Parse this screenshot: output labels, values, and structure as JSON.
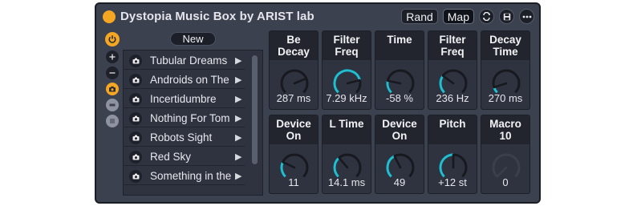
{
  "device": {
    "title": "Dystopia Music Box by ARIST lab",
    "rand_label": "Rand",
    "map_label": "Map"
  },
  "left_strip": {
    "buttons": [
      "power-icon",
      "plus-icon",
      "minus-icon",
      "camera-icon",
      "stop-icon",
      "list-icon"
    ]
  },
  "list": {
    "new_label": "New",
    "items": [
      {
        "label": "Tubular Dreams"
      },
      {
        "label": "Androids on The"
      },
      {
        "label": "Incertidumbre"
      },
      {
        "label": "Nothing For Tom"
      },
      {
        "label": "Robots Sight"
      },
      {
        "label": "Red Sky"
      },
      {
        "label": "Something in the"
      }
    ]
  },
  "knobs": [
    {
      "label": "Be\nDecay",
      "value": "287 ms",
      "level": 0.75,
      "color": "#1b1d24"
    },
    {
      "label": "Filter\nFreq",
      "value": "7.29 kHz",
      "level": 0.78,
      "color": "#1fbfd1"
    },
    {
      "label": "Time",
      "value": "-58 %",
      "level": 0.21,
      "color": "#1fbfd1"
    },
    {
      "label": "Filter\nFreq",
      "value": "236 Hz",
      "level": 0.3,
      "color": "#1fbfd1"
    },
    {
      "label": "Decay\nTime",
      "value": "270 ms",
      "level": 0.1,
      "color": "#1fbfd1"
    },
    {
      "label": "Device\nOn",
      "value": "11",
      "level": 0.26,
      "color": "#1fbfd1"
    },
    {
      "label": "L Time",
      "value": "14.1 ms",
      "level": 0.35,
      "color": "#1fbfd1"
    },
    {
      "label": "Device\nOn",
      "value": "49",
      "level": 0.4,
      "color": "#1fbfd1"
    },
    {
      "label": "Pitch",
      "value": "+12 st",
      "level": 0.5,
      "color": "#1fbfd1"
    },
    {
      "label": "Macro\n10",
      "value": "0",
      "level": 0.0,
      "color": "#1fbfd1"
    }
  ],
  "colors": {
    "accent": "#f5a623",
    "knob_active": "#1fbfd1",
    "panel": "#3c4150"
  }
}
